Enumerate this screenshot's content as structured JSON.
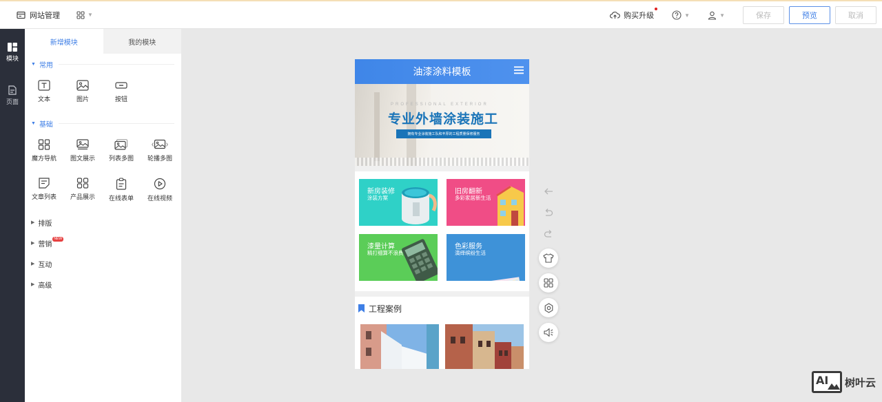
{
  "topbar": {
    "site_mgmt_label": "网站管理",
    "upgrade_label": "购买升级",
    "save_label": "保存",
    "preview_label": "预览",
    "cancel_label": "取消"
  },
  "rail": {
    "items": [
      {
        "label": "模块",
        "icon": "modules-icon"
      },
      {
        "label": "页面",
        "icon": "page-icon"
      }
    ]
  },
  "panel": {
    "tabs": [
      "新增模块",
      "我的模块"
    ],
    "sections": {
      "common": {
        "label": "常用",
        "items": [
          {
            "label": "文本",
            "icon": "text-icon"
          },
          {
            "label": "图片",
            "icon": "image-icon"
          },
          {
            "label": "按钮",
            "icon": "button-icon"
          }
        ]
      },
      "basic": {
        "label": "基础",
        "items": [
          {
            "label": "魔方导航",
            "icon": "cube-nav-icon"
          },
          {
            "label": "图文展示",
            "icon": "image-text-icon"
          },
          {
            "label": "列表多图",
            "icon": "multi-image-icon"
          },
          {
            "label": "轮播多图",
            "icon": "carousel-icon"
          },
          {
            "label": "文章列表",
            "icon": "article-list-icon"
          },
          {
            "label": "产品展示",
            "icon": "product-icon"
          },
          {
            "label": "在线表单",
            "icon": "form-icon"
          },
          {
            "label": "在线视频",
            "icon": "video-icon"
          }
        ]
      },
      "layout": {
        "label": "排版"
      },
      "marketing": {
        "label": "营销",
        "badge": "NEW"
      },
      "interaction": {
        "label": "互动"
      },
      "advanced": {
        "label": "高级"
      }
    }
  },
  "phone": {
    "title": "油漆涂料模板",
    "banner": {
      "en": "PROFESSIONAL EXTERIOR",
      "main": "专业外墙涂装施工",
      "sub": "拥有专业涂装施工队和丰厚的工程质量保修服务"
    },
    "cards": [
      {
        "title": "新房装修",
        "subtitle": "涂装方案"
      },
      {
        "title": "旧房翻新",
        "subtitle": "多彩家居新生活"
      },
      {
        "title": "漆量计算",
        "subtitle": "精打细算不浪费"
      },
      {
        "title": "色彩服务",
        "subtitle": "演绎缤纷生活"
      }
    ],
    "cases_title": "工程案例"
  },
  "watermark": {
    "logo": "AI",
    "text": "树叶云"
  },
  "colors": {
    "accent": "#3f7fe6",
    "rail_bg": "#2b2f3a",
    "header_blue": "#4a8eec"
  }
}
